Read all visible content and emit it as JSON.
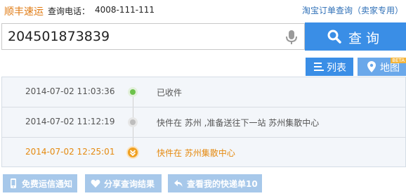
{
  "header": {
    "carrier_name": "顺丰速运",
    "phone_label": "查询电话：",
    "phone_number": "4008-111-111",
    "taobao_link": "淘宝订单查询（卖家专用）"
  },
  "search": {
    "tracking_number": "204501873839",
    "button_label": "查询"
  },
  "view_tabs": {
    "list_label": "列表",
    "map_label": "地图",
    "map_badge": "BETA"
  },
  "timeline": {
    "events": [
      {
        "time": "2014-07-02 11:03:36",
        "status": "已收件"
      },
      {
        "time": "2014-07-02 11:12:19",
        "status": "快件在 苏州 ,准备送往下一站 苏州集散中心"
      },
      {
        "time": "2014-07-02 12:25:01",
        "status": "快件在 苏州集散中心"
      }
    ]
  },
  "actions": {
    "free_notify": "免费运信通知",
    "share_result": "分享查询结果",
    "view_my_parcels": "查看我的快递单10"
  },
  "colors": {
    "brand_orange": "#e07a12",
    "primary_blue": "#3a8ee6",
    "link_blue": "#2e6fb7",
    "done_green": "#6cc24a",
    "latest_orange": "#f0a020"
  }
}
